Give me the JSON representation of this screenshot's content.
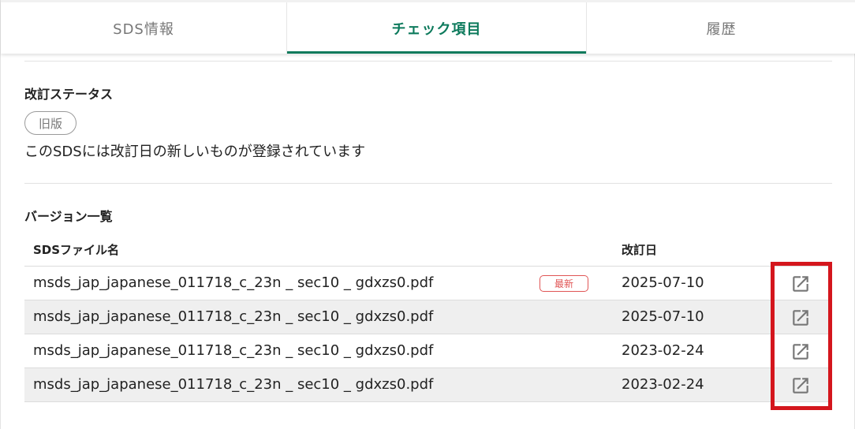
{
  "tabs": [
    {
      "label": "SDS情報"
    },
    {
      "label": "チェック項目"
    },
    {
      "label": "履歴"
    }
  ],
  "revision_status": {
    "title": "改訂ステータス",
    "chip": "旧版",
    "message": "このSDSには改訂日の新しいものが登録されています"
  },
  "versions": {
    "title": "バージョン一覧",
    "headers": {
      "file_name": "SDSファイル名",
      "revision_date": "改訂日"
    },
    "latest_badge": "最新",
    "rows": [
      {
        "file_name": "msds_jap_japanese_011718_c_23n _ sec10 _ gdxzs0.pdf",
        "revision_date": "2025-07-10",
        "latest": true
      },
      {
        "file_name": "msds_jap_japanese_011718_c_23n _ sec10 _ gdxzs0.pdf",
        "revision_date": "2025-07-10",
        "latest": false
      },
      {
        "file_name": "msds_jap_japanese_011718_c_23n _ sec10 _ gdxzs0.pdf",
        "revision_date": "2023-02-24",
        "latest": false
      },
      {
        "file_name": "msds_jap_japanese_011718_c_23n _ sec10 _ gdxzs0.pdf",
        "revision_date": "2023-02-24",
        "latest": false
      }
    ]
  },
  "icons": {
    "open": "external-link-icon"
  },
  "colors": {
    "accent": "#0d7a5c",
    "badge": "#e05555",
    "highlight": "#d4161d"
  }
}
